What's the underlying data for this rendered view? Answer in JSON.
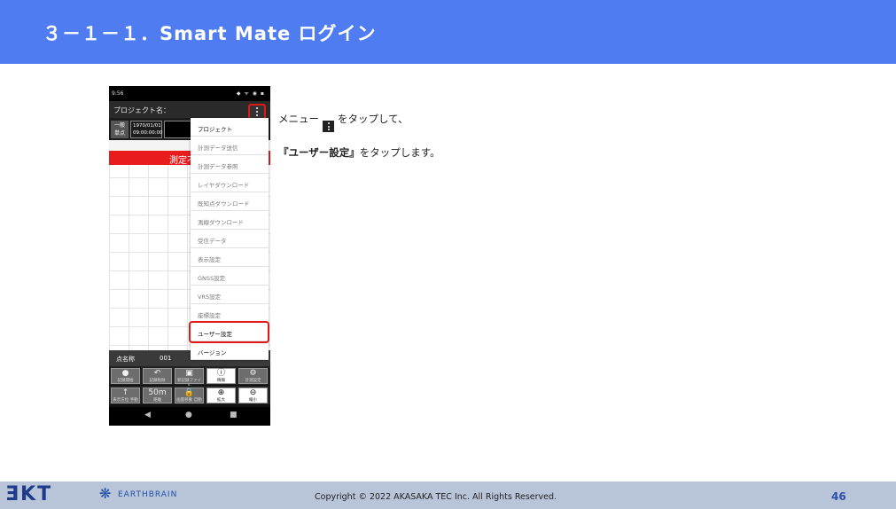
{
  "header": {
    "title": "３－１－１．Smart Mate ログイン"
  },
  "phone": {
    "status_time": "9:56",
    "status_icons": "◆ ᯤ ◉ ▪",
    "app_title": "プロジェクト名：",
    "mode_label_line1": "一般",
    "mode_label_line2": "単点",
    "date": "1970/01/01",
    "time": "09:00:00:00",
    "banner_text": "測定不",
    "point_label": "点名称",
    "point_value": "001",
    "buttons_row1": [
      {
        "glyph": "●",
        "label": "記録開始",
        "icon": "record-icon"
      },
      {
        "glyph": "↶",
        "label": "記録削除",
        "icon": "undo-icon"
      },
      {
        "glyph": "▣",
        "label": "新記録ファイル",
        "icon": "save-icon"
      },
      {
        "glyph": "ⓘ",
        "label": "情報",
        "icon": "info-icon"
      },
      {
        "glyph": "⚙",
        "label": "計測設定",
        "icon": "settings-icon"
      }
    ],
    "buttons_row2": [
      {
        "glyph": "↑",
        "label": "表示方位 手動",
        "icon": "arrow-up-icon"
      },
      {
        "glyph": "50m",
        "label": "距離",
        "icon": "scale-icon"
      },
      {
        "glyph": "🔒",
        "label": "画面移動 自動",
        "icon": "lock-icon"
      },
      {
        "glyph": "⊕",
        "label": "拡大",
        "icon": "zoom-in-icon"
      },
      {
        "glyph": "⊖",
        "label": "縮小",
        "icon": "zoom-out-icon"
      }
    ],
    "nav": {
      "back": "◀",
      "home": "●",
      "recent": "■"
    }
  },
  "menu": {
    "items": [
      {
        "label": "プロジェクト",
        "style": "dark"
      },
      {
        "label": "計測データ送信",
        "style": "grey"
      },
      {
        "label": "計測データ参照",
        "style": "grey"
      },
      {
        "label": "レイヤダウンロード",
        "style": "grey"
      },
      {
        "label": "既知点ダウンロード",
        "style": "grey"
      },
      {
        "label": "測線ダウンロード",
        "style": "grey"
      },
      {
        "label": "受信データ",
        "style": "grey"
      },
      {
        "label": "表示設定",
        "style": "grey"
      },
      {
        "label": "GNSS設定",
        "style": "grey"
      },
      {
        "label": "VRS設定",
        "style": "grey"
      },
      {
        "label": "座標設定",
        "style": "grey"
      },
      {
        "label": "ユーザー設定",
        "style": "dark"
      },
      {
        "label": "バージョン",
        "style": "dark"
      }
    ]
  },
  "instructions": {
    "line1_before": "メニュー",
    "line1_after": "をタップして、",
    "line2_bold": "『ユーザー設定』",
    "line2_after": "をタップします。"
  },
  "footer": {
    "logo": "ƎKT",
    "brand": "EARTHBRAIN",
    "copyright": "Copyright © 2022 AKASAKA TEC Inc. All Rights Reserved.",
    "page": "46"
  },
  "colors": {
    "header_bg": "#4f7cf0",
    "footer_bg": "#b8c5d8",
    "highlight_red": "#e01818",
    "banner_red": "#e81c1c"
  }
}
